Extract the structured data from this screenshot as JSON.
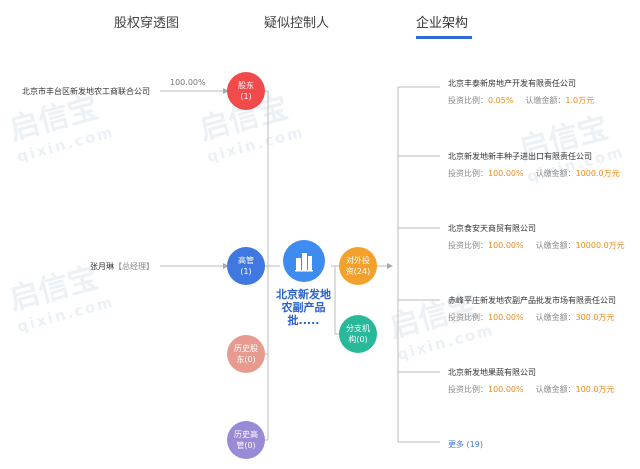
{
  "tabs": [
    {
      "label": "股权穿透图"
    },
    {
      "label": "疑似控制人"
    },
    {
      "label": "企业架构"
    }
  ],
  "watermark": {
    "main": "启信宝",
    "sub": "qixin.com"
  },
  "shareholder": {
    "name": "北京市丰台区新发地农工商联合公司",
    "percent": "100.00%"
  },
  "executive": {
    "name": "张月琳",
    "title": "【总经理】"
  },
  "nodes": {
    "shareholder": {
      "line1": "股东",
      "line2": "(1)"
    },
    "executive": {
      "line1": "高管",
      "line2": "(1)"
    },
    "hist_shareholder": {
      "line1": "历史股",
      "line2": "东(0)"
    },
    "hist_executive": {
      "line1": "历史高",
      "line2": "管(0)"
    },
    "investment": {
      "line1": "对外投",
      "line2": "资(24)"
    },
    "branch": {
      "line1": "分支机",
      "line2": "构(0)"
    }
  },
  "center": {
    "name": "北京新发地农副产品批....."
  },
  "labels": {
    "ratio": "投资比例：",
    "amount": "认缴金额："
  },
  "companies": [
    {
      "name": "北京丰泰新房地产开发有限责任公司",
      "ratio": "0.05%",
      "amount": "1.0万元"
    },
    {
      "name": "北京新发地新丰种子进出口有限责任公司",
      "ratio": "100.00%",
      "amount": "1000.0万元"
    },
    {
      "name": "北京食安天商贸有限公司",
      "ratio": "100.00%",
      "amount": "10000.0万元"
    },
    {
      "name": "赤峰平庄新发地农副产品批发市场有限责任公司",
      "ratio": "100.00%",
      "amount": "300.0万元"
    },
    {
      "name": "北京新发地果蔬有限公司",
      "ratio": "100.00%",
      "amount": "100.0万元"
    }
  ],
  "more": "更多 (19)",
  "colors": {
    "accent": "#2f6bd8",
    "value": "#f08a1c",
    "red": "#f04a4a",
    "blue": "#3e78e0",
    "orange": "#f3a12a",
    "green": "#27b99a"
  }
}
